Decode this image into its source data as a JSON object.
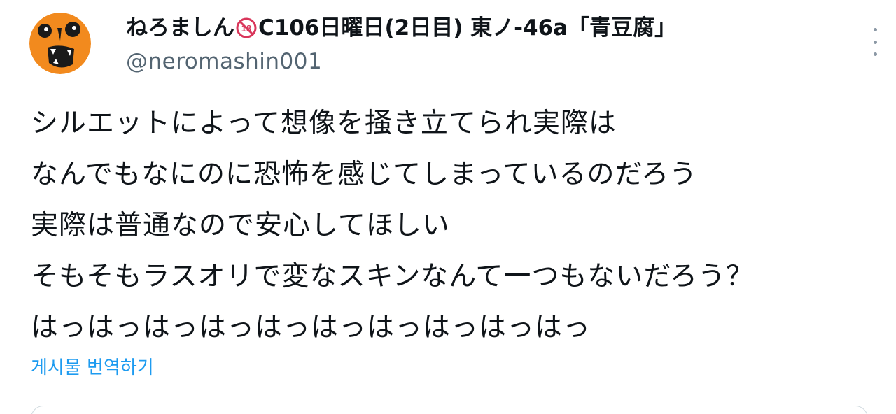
{
  "tweet": {
    "display_name_prefix": "ねろましん",
    "adult_badge_text": "18",
    "display_name_suffix": "C106日曜日(2日目) 東ノ-46a「青豆腐」",
    "handle": "@neromashin001",
    "body_lines": [
      "シルエットによって想像を掻き立てられ実際は",
      "なんでもなにのに恐怖を感じてしまっているのだろう",
      "実際は普通なので安心してほしい",
      "そもそもラスオリで変なスキンなんて一つもないだろう？",
      "はっはっはっはっはっはっはっはっはっはっ"
    ],
    "translate_label": "게시물 번역하기"
  },
  "icons": {
    "more": "more-vertical-icon",
    "adult_badge": "adult-18-badge-icon",
    "avatar": "avatar-image"
  },
  "colors": {
    "link": "#1d9bf0",
    "secondary_text": "#536471",
    "avatar_orange": "#f28a1e",
    "badge_red": "#d9365b"
  }
}
